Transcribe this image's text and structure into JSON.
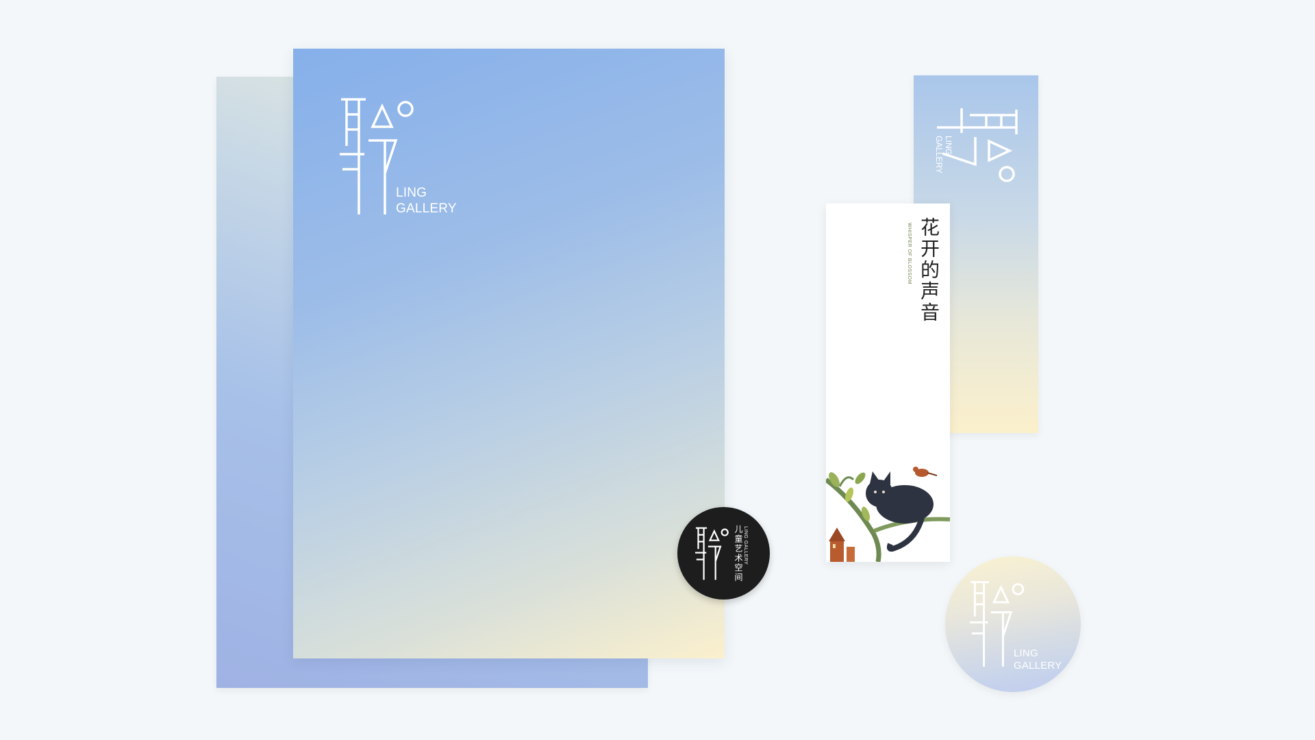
{
  "brand": {
    "name_line1": "LING",
    "name_line2": "GALLERY",
    "tagline_cn": "儿童艺术空间"
  },
  "bookmark": {
    "title_cn": "花开的声音",
    "subtitle_en": "WHISPER OF BLOSSOM"
  },
  "colors": {
    "background": "#f3f7f9",
    "gradient_blue": "#86b0ea",
    "gradient_cream": "#fbf0cd",
    "sticker_black": "#1d1d1d"
  },
  "icons": {
    "logo": "ling-gallery-logo-icon",
    "illustration": "cat-on-branch-illustration"
  }
}
